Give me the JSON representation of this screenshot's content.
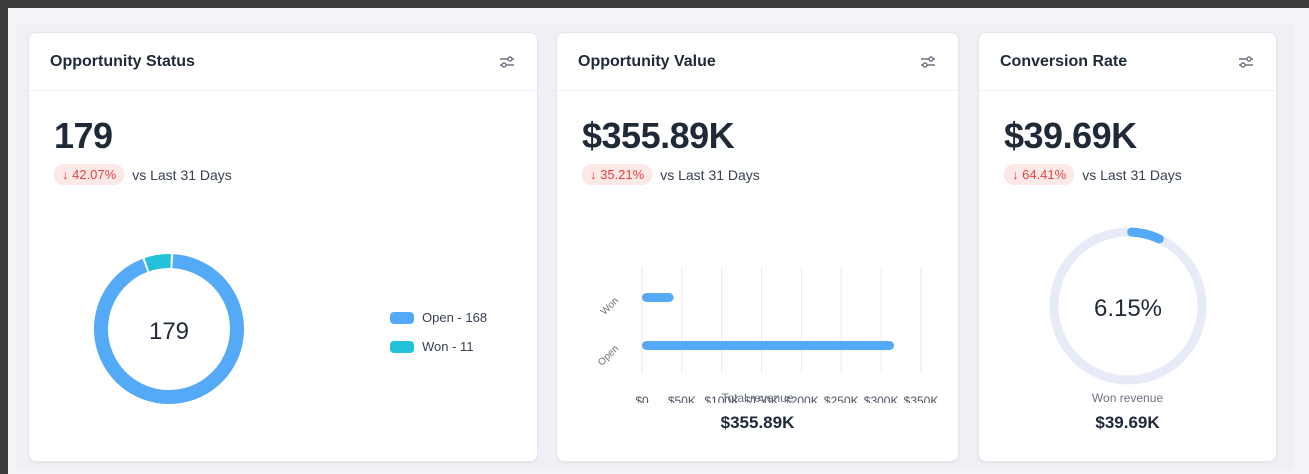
{
  "colors": {
    "open": "#55aaf7",
    "won": "#22c3d8",
    "track": "#e6ebf7",
    "negative": "#e04444"
  },
  "cards": [
    {
      "title": "Opportunity Status",
      "value": "179",
      "delta": "↓ 42.07%",
      "delta_suffix": "vs Last 31 Days",
      "donut_center": "179",
      "legend": [
        "Open - 168",
        "Won - 11"
      ]
    },
    {
      "title": "Opportunity Value",
      "value": "$355.89K",
      "delta": "↓ 35.21%",
      "delta_suffix": "vs Last 31 Days",
      "footer_label": "Total revenue",
      "footer_value": "$355.89K"
    },
    {
      "title": "Conversion Rate",
      "value": "$39.69K",
      "delta": "↓ 64.41%",
      "delta_suffix": "vs Last 31 Days",
      "gauge_center": "6.15%",
      "footer_label": "Won revenue",
      "footer_value": "$39.69K"
    }
  ],
  "chart_data": [
    {
      "type": "pie",
      "categories": [
        "Open",
        "Won"
      ],
      "values": [
        168,
        11
      ],
      "center_label": "179",
      "legend": "right"
    },
    {
      "type": "bar",
      "orientation": "horizontal",
      "categories": [
        "Won",
        "Open"
      ],
      "values": [
        39690,
        316200
      ],
      "xticks": [
        "$0",
        "$50K",
        "$100K",
        "$150K",
        "$200K",
        "$250K",
        "$300K",
        "$350K"
      ],
      "xlim": [
        0,
        350000
      ],
      "grid": true
    },
    {
      "type": "pie",
      "variant": "radial-gauge",
      "values": [
        6.15
      ],
      "max": 100,
      "center_label": "6.15%"
    }
  ]
}
